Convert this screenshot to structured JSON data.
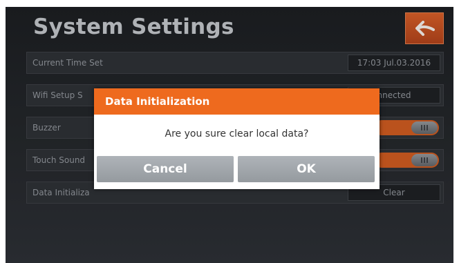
{
  "page": {
    "title": "System Settings"
  },
  "header": {
    "back_icon": "back-arrow-icon"
  },
  "settings": {
    "rows": [
      {
        "label": "Current Time Set",
        "value": "17:03  Jul.03.2016"
      },
      {
        "label": "Wifi Setup S",
        "value": "nnected"
      },
      {
        "label": "Buzzer",
        "toggle_on": true
      },
      {
        "label": "Touch Sound",
        "toggle_on": true
      },
      {
        "label": "Data Initializa",
        "value": "Clear"
      }
    ]
  },
  "dialog": {
    "title": "Data Initialization",
    "message": "Are you sure clear local data?",
    "cancel_label": "Cancel",
    "ok_label": "OK"
  },
  "colors": {
    "accent": "#ee6a1e",
    "toggle_on": "#c4571f",
    "background": "#1b1d20"
  }
}
